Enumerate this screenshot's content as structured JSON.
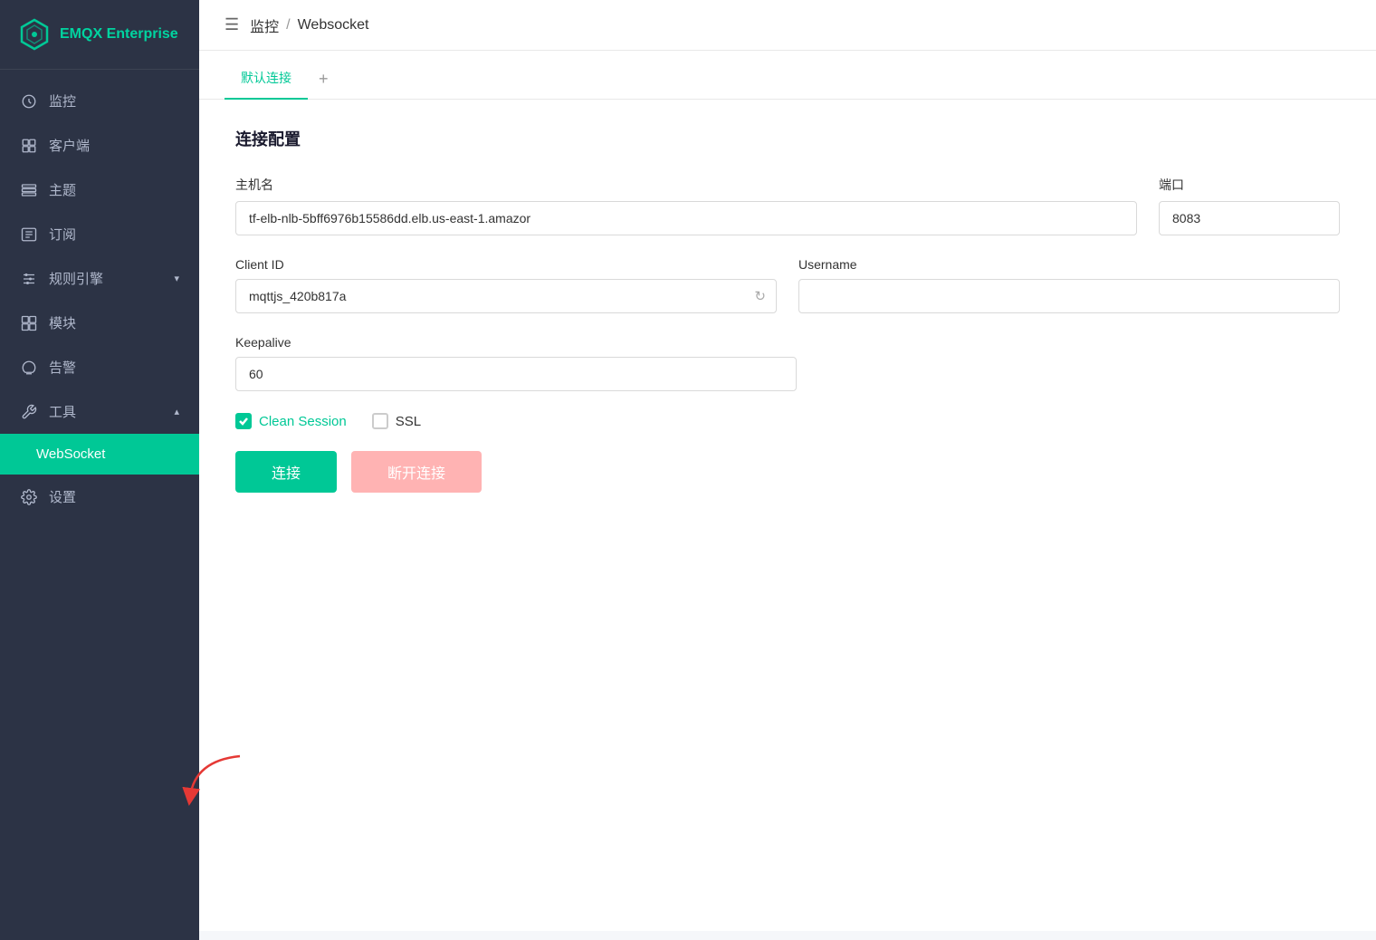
{
  "sidebar": {
    "logo": {
      "text": "EMQX Enterprise"
    },
    "items": [
      {
        "id": "monitor",
        "label": "监控",
        "icon": "monitor",
        "active": false,
        "hasArrow": false
      },
      {
        "id": "clients",
        "label": "客户端",
        "icon": "clients",
        "active": false,
        "hasArrow": false
      },
      {
        "id": "topics",
        "label": "主题",
        "icon": "topics",
        "active": false,
        "hasArrow": false
      },
      {
        "id": "subscriptions",
        "label": "订阅",
        "icon": "subscriptions",
        "active": false,
        "hasArrow": false
      },
      {
        "id": "rules",
        "label": "规则引擎",
        "icon": "rules",
        "active": false,
        "hasArrow": true
      },
      {
        "id": "modules",
        "label": "模块",
        "icon": "modules",
        "active": false,
        "hasArrow": false
      },
      {
        "id": "alerts",
        "label": "告警",
        "icon": "alerts",
        "active": false,
        "hasArrow": false
      },
      {
        "id": "tools",
        "label": "工具",
        "icon": "tools",
        "active": false,
        "hasArrow": true,
        "expanded": true
      },
      {
        "id": "websocket",
        "label": "WebSocket",
        "icon": "websocket",
        "active": true,
        "hasArrow": false,
        "indent": true
      },
      {
        "id": "settings",
        "label": "设置",
        "icon": "settings",
        "active": false,
        "hasArrow": false
      }
    ]
  },
  "topbar": {
    "breadcrumb_parent": "监控",
    "breadcrumb_sep": "/",
    "breadcrumb_current": "Websocket"
  },
  "tabs": [
    {
      "id": "default",
      "label": "默认连接",
      "active": true
    }
  ],
  "tab_add_label": "+",
  "form": {
    "section_title": "连接配置",
    "host_label": "主机名",
    "host_value": "tf-elb-nlb-5bff6976b15586dd.elb.us-east-1.amazor",
    "port_label": "端口",
    "port_value": "8083",
    "client_id_label": "Client ID",
    "client_id_value": "mqttjs_420b817a",
    "username_label": "Username",
    "username_value": "",
    "keepalive_label": "Keepalive",
    "keepalive_value": "60",
    "clean_session_label": "Clean Session",
    "clean_session_checked": true,
    "ssl_label": "SSL",
    "ssl_checked": false,
    "btn_connect": "连接",
    "btn_disconnect": "断开连接"
  },
  "colors": {
    "accent": "#00c896",
    "sidebar_bg": "#2c3345",
    "active_nav": "#00c896"
  }
}
